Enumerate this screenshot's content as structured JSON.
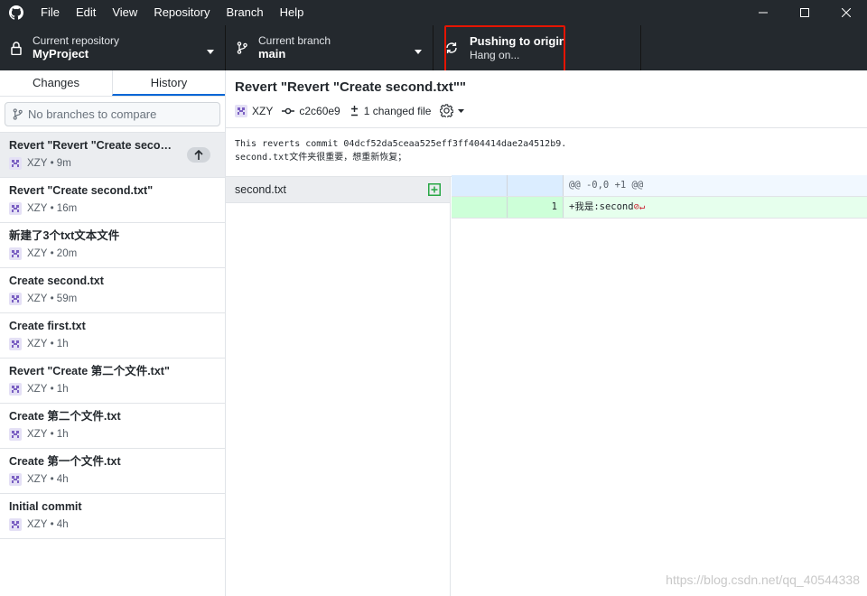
{
  "titlebar": {
    "menu": [
      "File",
      "Edit",
      "View",
      "Repository",
      "Branch",
      "Help"
    ],
    "logo_icon": "github-octocat-icon"
  },
  "toolbar": {
    "repo_label": "Current repository",
    "repo_value": "MyProject",
    "branch_label": "Current branch",
    "branch_value": "main",
    "push_label": "Pushing to origin",
    "push_value": "Hang on...",
    "highlight_color": "#e51400"
  },
  "sidebar": {
    "tabs": [
      "Changes",
      "History"
    ],
    "active_tab": "History",
    "compare_placeholder": "No branches to compare",
    "commits": [
      {
        "title": "Revert \"Revert \"Create second.txt\"\"",
        "author": "XZY",
        "time": "9m",
        "unpushed": true
      },
      {
        "title": "Revert \"Create second.txt\"",
        "author": "XZY",
        "time": "16m"
      },
      {
        "title": "新建了3个txt文本文件",
        "author": "XZY",
        "time": "20m"
      },
      {
        "title": "Create second.txt",
        "author": "XZY",
        "time": "59m"
      },
      {
        "title": "Create first.txt",
        "author": "XZY",
        "time": "1h"
      },
      {
        "title": "Revert \"Create 第二个文件.txt\"",
        "author": "XZY",
        "time": "1h"
      },
      {
        "title": "Create 第二个文件.txt",
        "author": "XZY",
        "time": "1h"
      },
      {
        "title": "Create 第一个文件.txt",
        "author": "XZY",
        "time": "4h"
      },
      {
        "title": "Initial commit",
        "author": "XZY",
        "time": "4h"
      }
    ]
  },
  "main": {
    "summary": "Revert \"Revert \"Create second.txt\"\"",
    "author": "XZY",
    "sha": "c2c60e9",
    "changed_files": "1 changed file",
    "body_line1": "This reverts commit 04dcf52da5ceaa525eff3ff404414dae2a4512b9.",
    "body_line2": "second.txt文件夹很重要，想重新恢复；",
    "file_name": "second.txt",
    "diff": {
      "hunk_header": "@@ -0,0 +1 @@",
      "line_number": "1",
      "added_line": "+我是:second"
    }
  },
  "watermark": "https://blog.csdn.net/qq_40544338"
}
